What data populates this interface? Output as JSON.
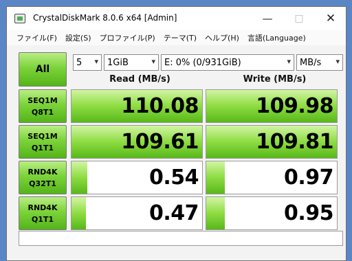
{
  "window": {
    "title": "CrystalDiskMark 8.0.6 x64 [Admin]",
    "controls": {
      "minimize": "—",
      "maximize": "□",
      "close": "✕"
    }
  },
  "menu": [
    "ファイル(F)",
    "設定(S)",
    "プロファイル(P)",
    "テーマ(T)",
    "ヘルプ(H)",
    "言語(Language)"
  ],
  "toolbar": {
    "all_label": "All",
    "count": "5",
    "size": "1GiB",
    "drive": "E: 0% (0/931GiB)",
    "unit": "MB/s"
  },
  "headers": {
    "read": "Read (MB/s)",
    "write": "Write (MB/s)"
  },
  "tests": [
    {
      "line1": "SEQ1M",
      "line2": "Q8T1",
      "read": "110.08",
      "write": "109.98",
      "read_fill": 1.0,
      "write_fill": 1.0
    },
    {
      "line1": "SEQ1M",
      "line2": "Q1T1",
      "read": "109.61",
      "write": "109.81",
      "read_fill": 1.0,
      "write_fill": 1.0
    },
    {
      "line1": "RND4K",
      "line2": "Q32T1",
      "read": "0.54",
      "write": "0.97",
      "read_fill": 0.12,
      "write_fill": 0.14
    },
    {
      "line1": "RND4K",
      "line2": "Q1T1",
      "read": "0.47",
      "write": "0.95",
      "read_fill": 0.11,
      "write_fill": 0.14
    }
  ],
  "status": ""
}
